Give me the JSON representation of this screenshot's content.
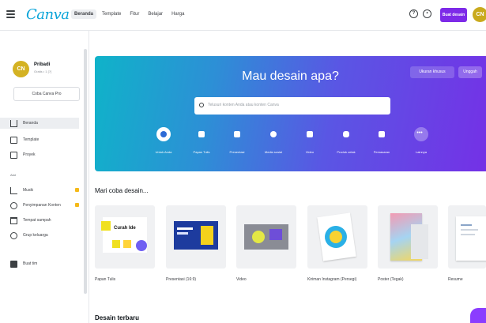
{
  "header": {
    "logo": "Canva",
    "nav": [
      "Beranda",
      "Template",
      "Fitur",
      "Belajar",
      "Harga"
    ],
    "create_button": "Buat desain",
    "avatar_initials": "CN"
  },
  "sidebar": {
    "user": {
      "initials": "CN",
      "name": "Pribadi",
      "subtitle": "Gratis • 1 [?]"
    },
    "pro_button": "Coba Canva Pro",
    "items": [
      {
        "label": "Beranda",
        "icon": "home-icon",
        "active": true
      },
      {
        "label": "Template",
        "icon": "template-icon"
      },
      {
        "label": "Proyek",
        "icon": "folder-icon"
      }
    ],
    "section_label": "Alat",
    "tools": [
      {
        "label": "Musik",
        "icon": "music-icon",
        "pro": true
      },
      {
        "label": "Penyimpanan Konten",
        "icon": "brand-kit-icon",
        "pro": true
      },
      {
        "label": "Tempat sampah",
        "icon": "trash-icon"
      },
      {
        "label": "Grup keluarga",
        "icon": "globe-icon"
      }
    ],
    "bottom_item": {
      "label": "Buat tim",
      "icon": "team-icon"
    }
  },
  "hero": {
    "title": "Mau desain apa?",
    "custom_size_button": "Ukuran khusus",
    "upload_button": "Unggah",
    "search_placeholder": "Telusuri konten Anda atau konten Canva",
    "categories": [
      {
        "label": "Untuk Anda",
        "icon": "sparkle-icon"
      },
      {
        "label": "Papan Tulis",
        "icon": "whiteboard-icon"
      },
      {
        "label": "Presentasi",
        "icon": "presentation-icon"
      },
      {
        "label": "Media sosial",
        "icon": "heart-icon"
      },
      {
        "label": "Video",
        "icon": "video-icon"
      },
      {
        "label": "Produk cetak",
        "icon": "print-icon"
      },
      {
        "label": "Pemasaran",
        "icon": "megaphone-icon"
      },
      {
        "label": "Lainnya",
        "icon": "more-icon"
      }
    ]
  },
  "designs": {
    "title": "Mari coba desain...",
    "items": [
      {
        "label": "Papan Tulis",
        "thumb": "whiteboard",
        "text": "Curah Ide"
      },
      {
        "label": "Presentasi (16:9)",
        "thumb": "presentation"
      },
      {
        "label": "Video",
        "thumb": "video"
      },
      {
        "label": "Kiriman Instagram (Persegi)",
        "thumb": "instagram"
      },
      {
        "label": "Poster (Tegak)",
        "thumb": "poster"
      },
      {
        "label": "Resume",
        "thumb": "resume"
      }
    ]
  },
  "recent": {
    "title": "Desain terbaru"
  },
  "colors": {
    "accent": "#7d2ae8",
    "logo": "#0aa4d9"
  }
}
